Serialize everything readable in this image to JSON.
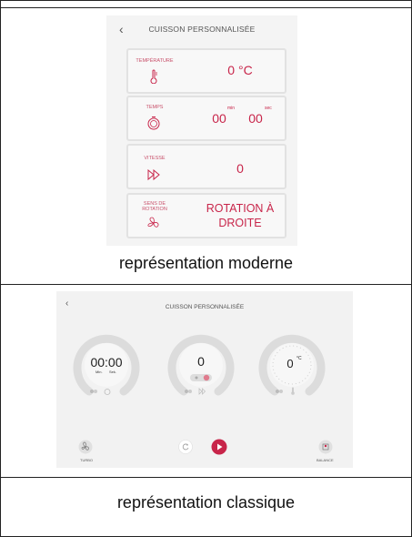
{
  "modern": {
    "back_icon": "‹",
    "title": "CUISSON PERSONNALISÉE",
    "cards": [
      {
        "label": "TEMPÉRATURE",
        "icon": "thermometer-icon",
        "value": "0 °C"
      },
      {
        "label": "TEMPS",
        "icon": "timer-icon",
        "min_value": "00",
        "min_unit": "min",
        "sec_value": "00",
        "sec_unit": "sec"
      },
      {
        "label": "VITESSE",
        "icon": "speed-icon",
        "value": "0"
      },
      {
        "label_line1": "SENS DE",
        "label_line2": "ROTATION",
        "icon": "rotation-icon",
        "value_line1": "ROTATION À",
        "value_line2": "DROITE"
      }
    ],
    "caption": "représentation moderne"
  },
  "classic": {
    "back_icon": "‹",
    "title": "CUISSON PERSONNALISÉE",
    "time_dial": {
      "value": "00:00",
      "min_label": "Min.",
      "sec_label": "Sek."
    },
    "speed_dial": {
      "value": "0"
    },
    "temp_dial": {
      "value": "0",
      "unit": "°C"
    },
    "turbo_label": "TURBO",
    "balance_label": "BALANCE",
    "caption": "représentation classique"
  },
  "colors": {
    "accent": "#c8254a",
    "card_border": "#e2e2e2",
    "dial_gray": "#dcdcdc"
  }
}
